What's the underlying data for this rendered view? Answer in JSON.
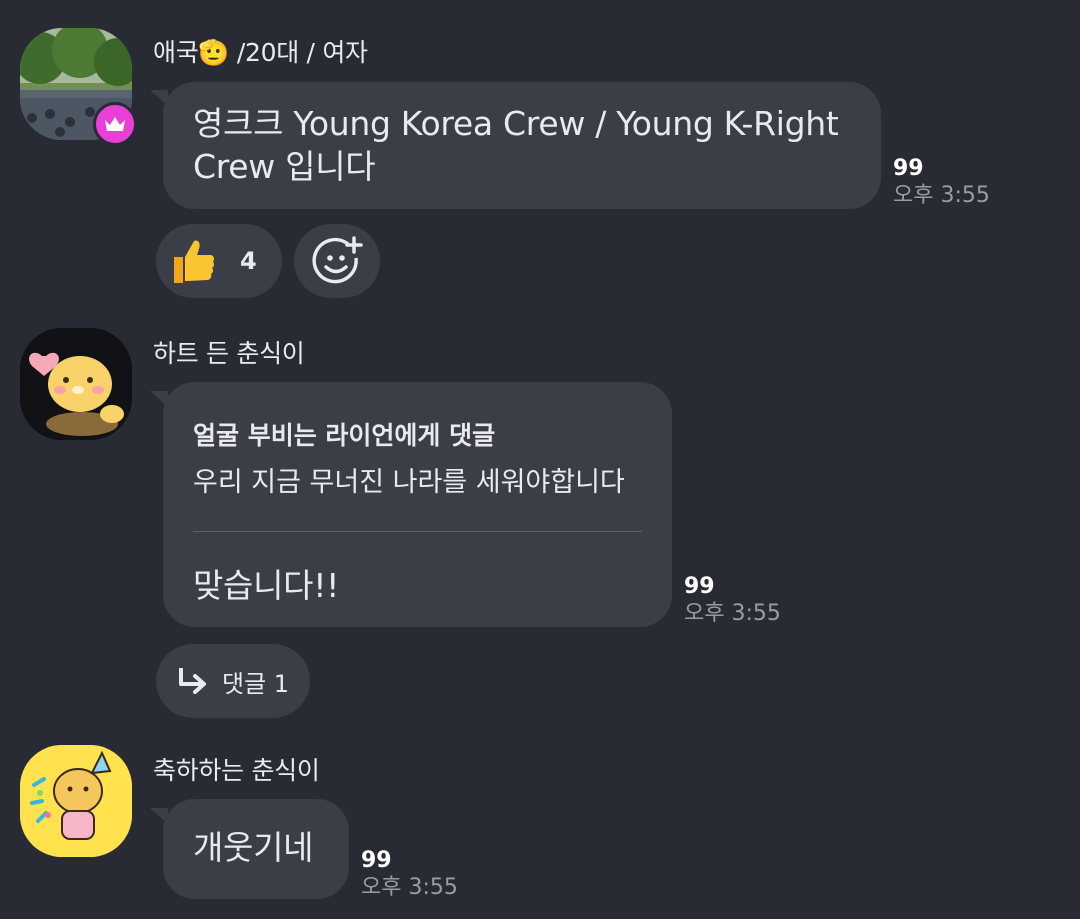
{
  "messages": [
    {
      "sender": "애국🫡 /20대 / 여자",
      "text": "영크크 Young Korea Crew / Young K-Right Crew 입니다",
      "count": "99",
      "time": "오후 3:55",
      "reaction": {
        "icon": "thumbs-up-icon",
        "count": "4"
      }
    },
    {
      "sender": "하트 든 춘식이",
      "reply_to": "얼굴 부비는 라이언에게 댓글",
      "quoted": "우리 지금 무너진 나라를 세워야합니다",
      "text": "맞습니다!!",
      "count": "99",
      "time": "오후 3:55",
      "comments_label": "댓글 1"
    },
    {
      "sender": "축하하는 춘식이",
      "text": "개웃기네",
      "count": "99",
      "time": "오후 3:55"
    }
  ],
  "colors": {
    "background": "#282b33",
    "bubble": "#3b3e46",
    "crown_badge": "#e93fd6",
    "sticker_yellow": "#ffe24d"
  }
}
